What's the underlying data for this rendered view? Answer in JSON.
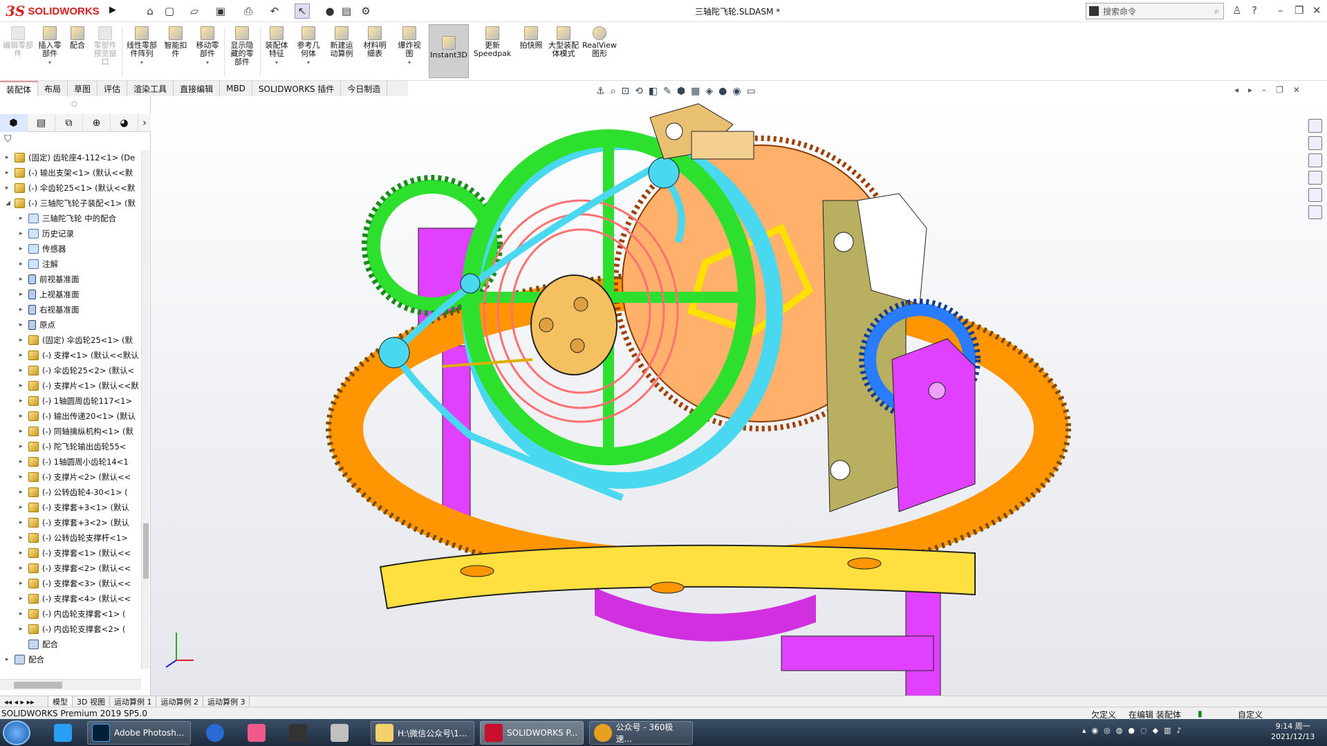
{
  "titlebar": {
    "logo_mark": "3S",
    "logo_text": "SOLIDWORKS",
    "doc_title": "三轴陀飞轮.SLDASM *",
    "search_placeholder": "搜索命令",
    "help": "?"
  },
  "ribbon": {
    "buttons": [
      {
        "label": "编辑零部件",
        "disabled": true
      },
      {
        "label": "插入零部件"
      },
      {
        "label": "配合"
      },
      {
        "label": "零部件预览窗口",
        "disabled": true
      },
      {
        "label": "线性零部件阵列"
      },
      {
        "label": "智能扣件"
      },
      {
        "label": "移动零部件"
      },
      {
        "label": "显示隐藏的零部件"
      },
      {
        "label": "装配体特征"
      },
      {
        "label": "参考几何体"
      },
      {
        "label": "新建运动算例"
      },
      {
        "label": "材料明细表"
      },
      {
        "label": "爆炸视图"
      },
      {
        "label": "Instant3D",
        "active": true
      },
      {
        "label": "更新Speedpak"
      },
      {
        "label": "拍快照"
      },
      {
        "label": "大型装配体模式"
      },
      {
        "label": "RealView图形"
      }
    ]
  },
  "tabs": [
    "装配体",
    "布局",
    "草图",
    "评估",
    "渲染工具",
    "直接编辑",
    "MBD",
    "SOLIDWORKS 插件",
    "今日制造"
  ],
  "tree": [
    {
      "label": "(固定) 齿轮座4-112<1> (De",
      "level": 0,
      "icon": "part"
    },
    {
      "label": "(-) 输出支架<1> (默认<<默",
      "level": 0,
      "icon": "part"
    },
    {
      "label": "(-) 伞齿轮25<1> (默认<<默",
      "level": 0,
      "icon": "part"
    },
    {
      "label": "(-) 三轴陀飞轮子装配<1> (默",
      "level": 0,
      "icon": "part",
      "open": true
    },
    {
      "label": "三轴陀飞轮 中的配合",
      "level": 1,
      "icon": "doc"
    },
    {
      "label": "历史记录",
      "level": 1,
      "icon": "doc"
    },
    {
      "label": "传感器",
      "level": 1,
      "icon": "doc"
    },
    {
      "label": "注解",
      "level": 1,
      "icon": "doc"
    },
    {
      "label": "前视基准面",
      "level": 1,
      "icon": "plane"
    },
    {
      "label": "上视基准面",
      "level": 1,
      "icon": "plane"
    },
    {
      "label": "右视基准面",
      "level": 1,
      "icon": "plane"
    },
    {
      "label": "原点",
      "level": 1,
      "icon": "plane"
    },
    {
      "label": "(固定) 伞齿轮25<1> (默",
      "level": 1,
      "icon": "part"
    },
    {
      "label": "(-) 支撑<1> (默认<<默认",
      "level": 1,
      "icon": "part"
    },
    {
      "label": "(-) 伞齿轮25<2> (默认<",
      "level": 1,
      "icon": "part"
    },
    {
      "label": "(-) 支撑片<1> (默认<<默",
      "level": 1,
      "icon": "part"
    },
    {
      "label": "(-) 1轴圆周齿轮117<1>",
      "level": 1,
      "icon": "part"
    },
    {
      "label": "(-) 输出传递20<1> (默认",
      "level": 1,
      "icon": "part"
    },
    {
      "label": "(-) 同轴擒纵机构<1> (默",
      "level": 1,
      "icon": "part"
    },
    {
      "label": "(-) 陀飞轮输出齿轮55<",
      "level": 1,
      "icon": "part"
    },
    {
      "label": "(-) 1轴圆周小齿轮14<1",
      "level": 1,
      "icon": "part"
    },
    {
      "label": "(-) 支撑片<2> (默认<<",
      "level": 1,
      "icon": "part"
    },
    {
      "label": "(-) 公转齿轮4-30<1> (",
      "level": 1,
      "icon": "part"
    },
    {
      "label": "(-) 支撑套+3<1> (默认",
      "level": 1,
      "icon": "part"
    },
    {
      "label": "(-) 支撑套+3<2> (默认",
      "level": 1,
      "icon": "part"
    },
    {
      "label": "(-) 公转齿轮支撑杆<1>",
      "level": 1,
      "icon": "part"
    },
    {
      "label": "(-) 支撑套<1> (默认<<",
      "level": 1,
      "icon": "part"
    },
    {
      "label": "(-) 支撑套<2> (默认<<",
      "level": 1,
      "icon": "part"
    },
    {
      "label": "(-) 支撑套<3> (默认<<",
      "level": 1,
      "icon": "part"
    },
    {
      "label": "(-) 支撑套<4> (默认<<",
      "level": 1,
      "icon": "part"
    },
    {
      "label": "(-) 内齿轮支撑套<1> (",
      "level": 1,
      "icon": "part"
    },
    {
      "label": "(-) 内齿轮支撑套<2> (",
      "level": 1,
      "icon": "part"
    },
    {
      "label": "配合",
      "level": 1,
      "icon": "folder",
      "noarrow": true
    },
    {
      "label": "配合",
      "level": 0,
      "icon": "folder"
    }
  ],
  "bottom_tabs": [
    "模型",
    "3D 视图",
    "运动算例 1",
    "运动算例 2",
    "运动算例 3"
  ],
  "status": {
    "app": "SOLIDWORKS Premium 2019 SP5.0",
    "undefined": "欠定义",
    "editing": "在编辑 装配体",
    "custom": "自定义"
  },
  "taskbar": {
    "apps": [
      "Adobe Photosh...",
      "H:\\微信公众号\\1...",
      "SOLIDWORKS P...",
      "公众号 - 360极速..."
    ],
    "time": "9:14 周一",
    "date": "2021/12/13"
  },
  "colors": {
    "orange": "#ff8c00",
    "green": "#2ee02e",
    "cyan": "#4ad8f0",
    "magenta": "#e040ff",
    "yellow": "#ffff40",
    "gold": "#e8c070",
    "olive": "#b8b060"
  }
}
